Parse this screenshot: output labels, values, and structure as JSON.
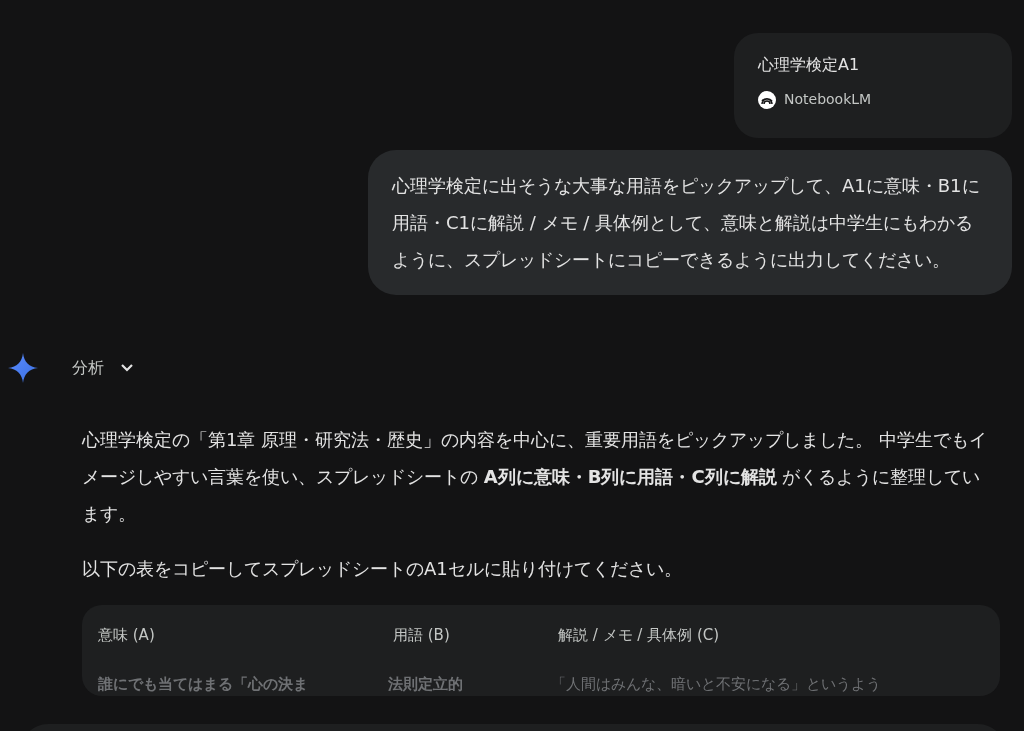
{
  "attachment": {
    "title": "心理学検定A1",
    "source": "NotebookLM"
  },
  "user_message": "心理学検定に出そうな大事な用語をピックアップして、A1に意味・B1に用語・C1に解説 / メモ / 具体例として、意味と解説は中学生にもわかるように、スプレッドシートにコピーできるように出力してください。",
  "thinking": {
    "label": "分析",
    "expanded": false
  },
  "response": {
    "paragraphs": [
      "心理学検定の「第1章 原理・研究法・歴史」の内容を中心に、重要用語をピックアップしました。 中学生でもイメージしやすい言葉を使い、スプレッドシートの **A列に意味・B列に用語・C列に解説** がくるように整理しています。",
      "以下の表をコピーしてスプレッドシートのA1セルに貼り付けてください。"
    ],
    "table": {
      "columns": [
        "意味 (A)",
        "用語 (B)",
        "解説 / メモ / 具体例 (C)"
      ],
      "rows": [
        [
          "誰にでも当てはまる「心の決ま",
          "法則定立的",
          "「人間はみんな、暗いと不安になる」というよう"
        ]
      ]
    }
  }
}
